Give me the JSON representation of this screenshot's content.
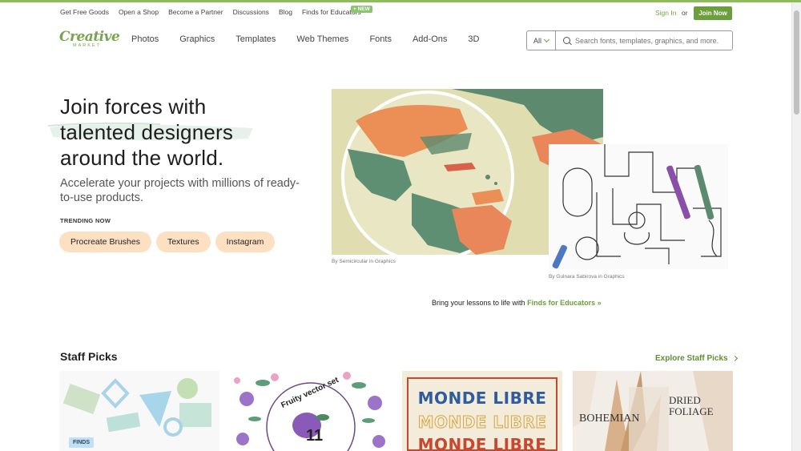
{
  "utility_bar": {
    "links": [
      "Get Free Goods",
      "Open a Shop",
      "Become a Partner",
      "Discussions",
      "Blog",
      "Finds for Educators"
    ],
    "new_badge": "+ NEW",
    "sign_in": "Sign In",
    "or": "or",
    "join_now": "Join Now"
  },
  "logo": {
    "main": "Creative",
    "sub": "MARKET"
  },
  "nav": {
    "items": [
      "Photos",
      "Graphics",
      "Templates",
      "Web Themes",
      "Fonts",
      "Add-Ons",
      "3D"
    ]
  },
  "search": {
    "category": "All",
    "placeholder": "Search fonts, templates, graphics, and more."
  },
  "hero": {
    "title_line1": "Join forces with",
    "title_line2": "talented designers",
    "title_line3": "around the world.",
    "subtitle": "Accelerate your projects with millions of ready-to-use products.",
    "trending_label": "TRENDING NOW",
    "trending": [
      "Procreate Brushes",
      "Textures",
      "Instagram"
    ],
    "caption1": "By Semicircular in Graphics",
    "caption2": "By Gulnara Sabirova in Graphics"
  },
  "educators": {
    "text": "Bring your lessons to life with",
    "link": "Finds for Educators »"
  },
  "staff_picks": {
    "title": "Staff Picks",
    "explore": "Explore Staff Picks",
    "finds_badge": "FINDS",
    "card2_text": "Fruity vector set",
    "card2_number": "11",
    "card3_lines": [
      "MONDE LIBRE",
      "MONDE LIBRE",
      "MONDE LIBRE"
    ],
    "card4_title_line1": "DRIED",
    "card4_title_line2": "FOLIAGE",
    "card4_side": "BOHEMIAN"
  },
  "colors": {
    "brand_green": "#6b9e3c",
    "pill_peach": "#fde0c2",
    "top_strip": "#8fbc5a"
  }
}
